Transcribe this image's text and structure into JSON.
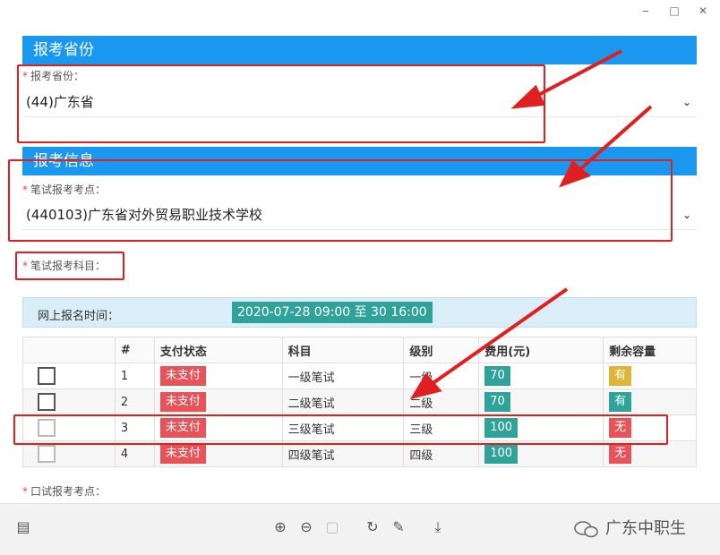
{
  "window": {
    "minimize": "‒",
    "maximize": "□",
    "close": "✕"
  },
  "section1": {
    "title": "报考省份"
  },
  "province": {
    "label": "报考省份：",
    "value": "(44)广东省"
  },
  "section2": {
    "title": "报考信息"
  },
  "exam_site": {
    "label": "笔试报考考点：",
    "value": "(440103)广东省对外贸易职业技术学校"
  },
  "subjects_label": "笔试报考科目：",
  "notice": {
    "label": "网上报名时间：",
    "time": "2020-07-28 09:00 至 30 16:00"
  },
  "table": {
    "headers": [
      "",
      "#",
      "支付状态",
      "科目",
      "级别",
      "费用(元)",
      "剩余容量"
    ],
    "rows": [
      {
        "no": "1",
        "pay": "未支付",
        "subject": "一级笔试",
        "level": "一级",
        "fee": "70",
        "cap": "有"
      },
      {
        "no": "2",
        "pay": "未支付",
        "subject": "二级笔试",
        "level": "二级",
        "fee": "70",
        "cap": "有"
      },
      {
        "no": "3",
        "pay": "未支付",
        "subject": "三级笔试",
        "level": "三级",
        "fee": "100",
        "cap": "无"
      },
      {
        "no": "4",
        "pay": "未支付",
        "subject": "四级笔试",
        "level": "四级",
        "fee": "100",
        "cap": "无"
      }
    ]
  },
  "oral_label": "口试报考考点：",
  "watermark": "广东中职生",
  "colors": {
    "header_blue": "#1a98f0",
    "annotation_red": "#e02020",
    "teal": "#2fa39a",
    "red_badge": "#e8535a",
    "yellow_badge": "#e0b435"
  }
}
